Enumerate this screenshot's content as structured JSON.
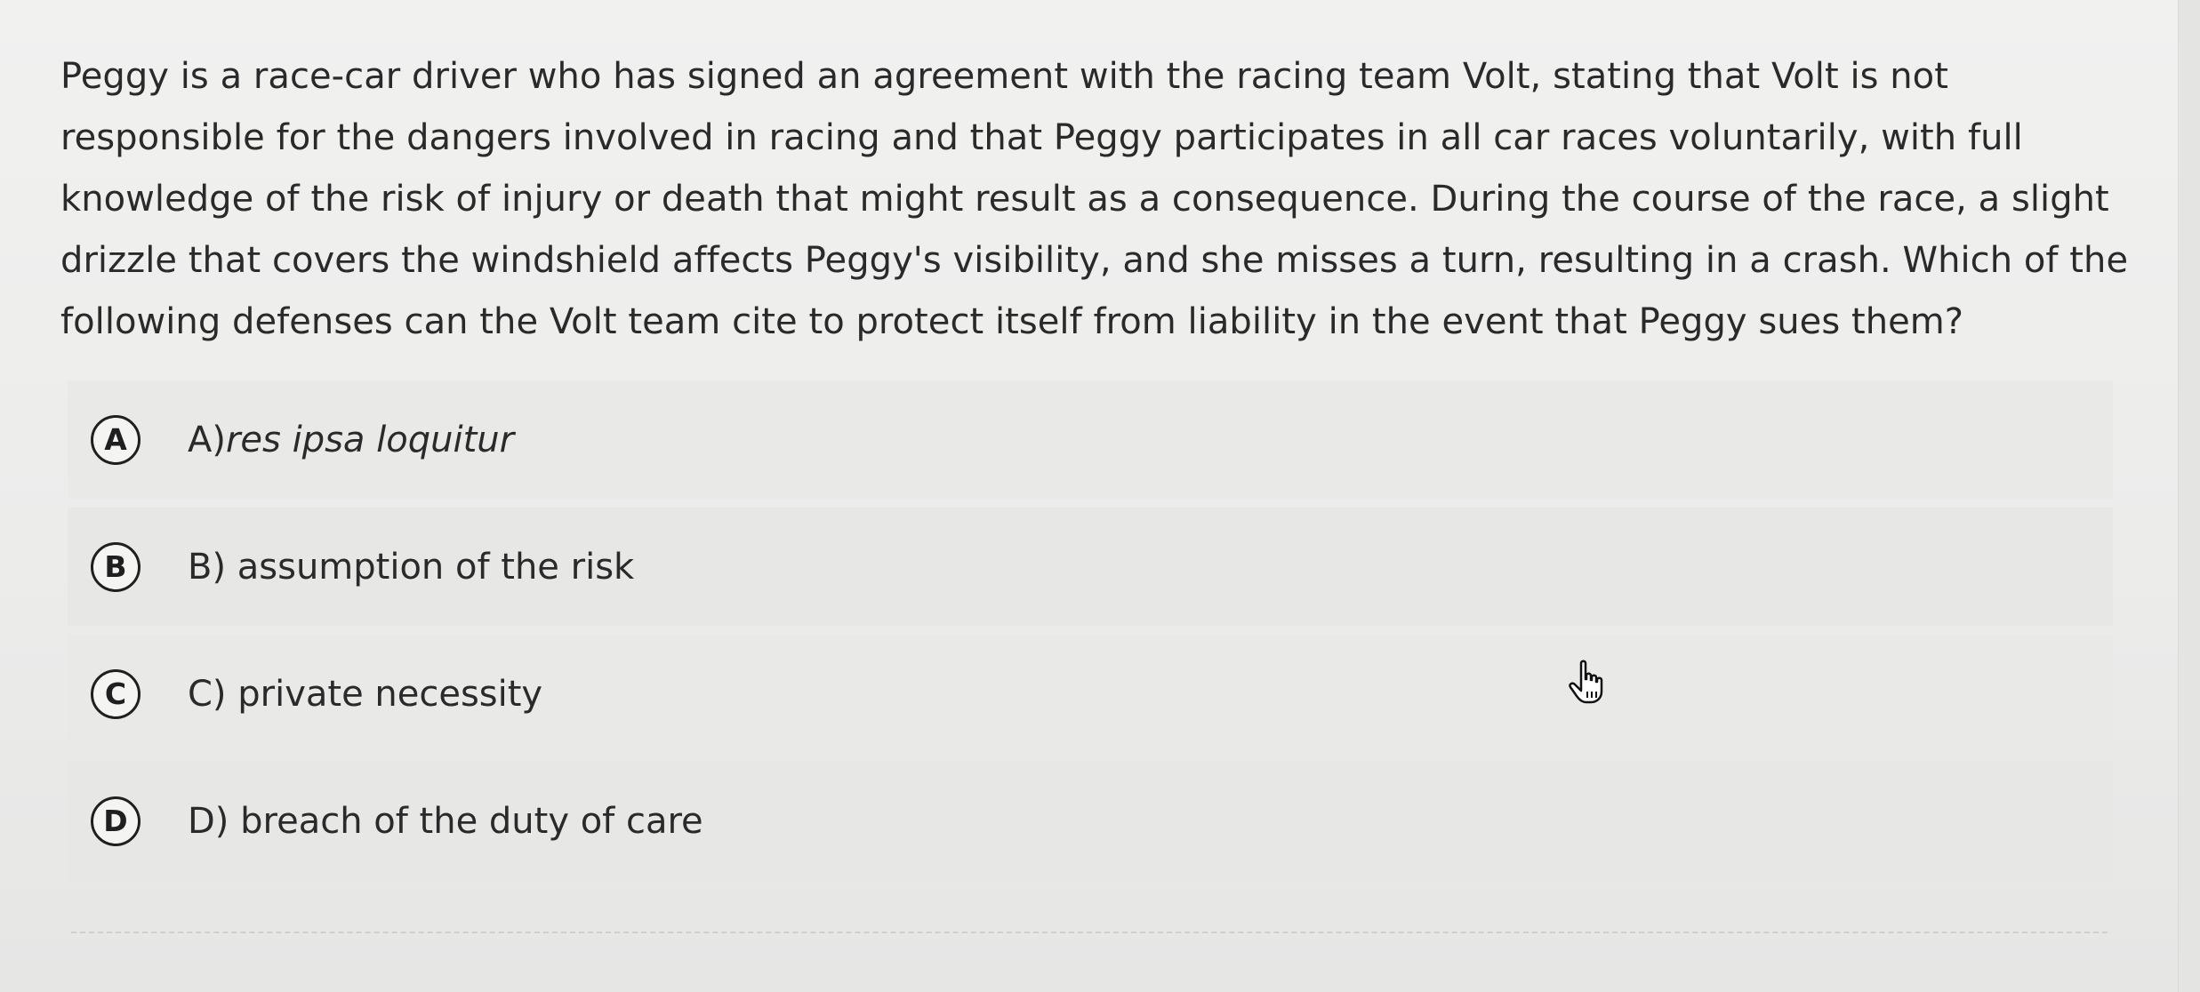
{
  "question": {
    "text": "Peggy is a race-car driver who has signed an agreement with the racing team Volt, stating that Volt is not responsible for the dangers involved in racing and that Peggy participates in all car races voluntarily, with full knowledge of the risk of injury or death that might result as a consequence. During the course of the race, a slight drizzle that covers the windshield affects Peggy's visibility, and she misses a turn, resulting in a crash. Which of the following defenses can the Volt team cite to protect itself from liability in the event that Peggy sues them?"
  },
  "options": [
    {
      "badge": "A",
      "prefix": "A)",
      "label": "res ipsa loquitur"
    },
    {
      "badge": "B",
      "prefix": "B) ",
      "label": "assumption of the risk"
    },
    {
      "badge": "C",
      "prefix": "C) ",
      "label": "private necessity"
    },
    {
      "badge": "D",
      "prefix": "D) ",
      "label": "breach of the duty of care"
    }
  ],
  "cursor": {
    "icon": "hand-pointer-icon"
  }
}
